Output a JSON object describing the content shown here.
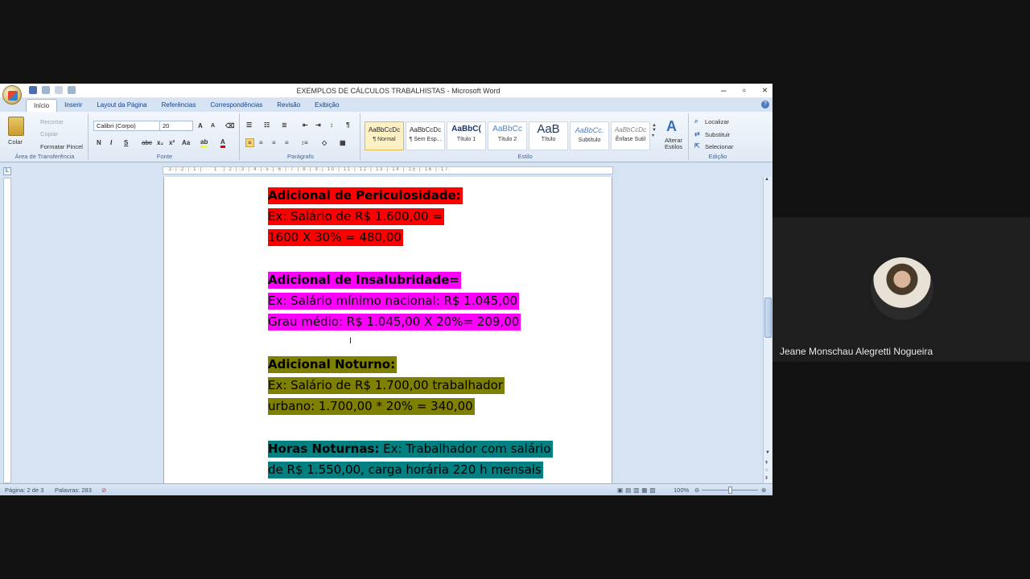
{
  "window": {
    "title": "EXEMPLOS DE CÁLCULOS TRABALHISTAS - Microsoft Word"
  },
  "tabs": [
    "Início",
    "Inserir",
    "Layout da Página",
    "Referências",
    "Correspondências",
    "Revisão",
    "Exibição"
  ],
  "ribbon": {
    "clipboard": {
      "paste": "Colar",
      "cut": "Recortar",
      "copy": "Copiar",
      "format_painter": "Formatar Pincel",
      "label": "Área de Transferência"
    },
    "font": {
      "name": "Calibri (Corpo)",
      "size": "20",
      "label": "Fonte"
    },
    "paragraph": {
      "label": "Parágrafo"
    },
    "styles": {
      "items": [
        {
          "preview": "AaBbCcDc",
          "name": "¶ Normal"
        },
        {
          "preview": "AaBbCcDc",
          "name": "¶ Sem Esp..."
        },
        {
          "preview": "AaBbC(",
          "name": "Título 1"
        },
        {
          "preview": "AaBbCc",
          "name": "Título 2"
        },
        {
          "preview": "AaB",
          "name": "Título"
        },
        {
          "preview": "AaBbCc.",
          "name": "Subtítulo"
        },
        {
          "preview": "AaBbCcDc",
          "name": "Ênfase Sutil"
        }
      ],
      "change": "Alterar Estilos",
      "label": "Estilo"
    },
    "editing": {
      "find": "Localizar",
      "replace": "Substituir",
      "select": "Selecionar",
      "label": "Edição"
    }
  },
  "document": {
    "p1_title": "Adicional de Periculosidade:",
    "p1_l1": "Ex: Salário de R$ 1.600,00 =",
    "p1_l2": "1600 X 30% = 480,00",
    "p2_title": "Adicional de Insalubridade=",
    "p2_l1": "Ex: Salário mínimo nacional: R$ 1.045,00",
    "p2_l2": "Grau médio: R$ 1.045,00 X 20%= 209,00",
    "p3_title": "Adicional Noturno:",
    "p3_l1": "Ex: Salário de R$ 1.700,00 trabalhador",
    "p3_l2": "urbano: 1.700,00 * 20% = 340,00",
    "p4_bold": "Horas Noturnas:",
    "p4_l1_rest": " Ex: Trabalhador com salário",
    "p4_l2": "de R$ 1.550,00, carga horária 220 h mensais"
  },
  "status": {
    "page": "Página: 2 de 3",
    "words": "Palavras: 283",
    "zoom": "100%"
  },
  "participant": {
    "name": "Jeane Monschau Alegretti Nogueira"
  },
  "colors": {
    "red": "#ff0000",
    "magenta": "#ff00ff",
    "olive": "#808000",
    "teal": "#008080"
  }
}
